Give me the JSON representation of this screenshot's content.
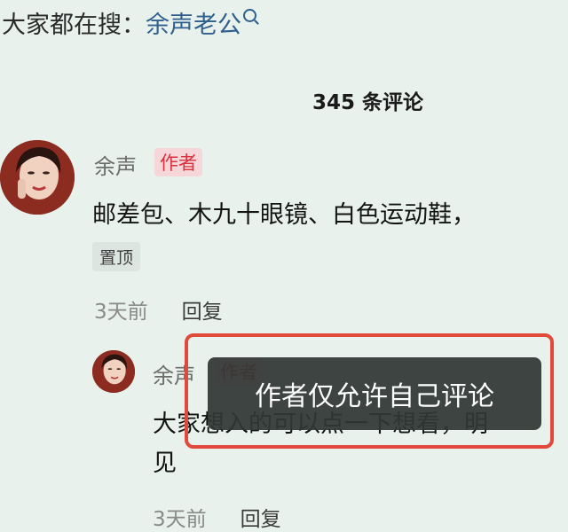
{
  "search_hint": {
    "prefix": "大家都在搜：",
    "keyword": "余声老公"
  },
  "comment_count": "345 条评论",
  "comments": [
    {
      "username": "余声",
      "badge": "作者",
      "text": "邮差包、木九十眼镜、白色运动鞋，",
      "pin": "置顶",
      "time": "3天前",
      "reply": "回复"
    },
    {
      "username": "余声",
      "badge": "作者",
      "text": "大家想入的可以点一下想看，明",
      "text_line2": "见",
      "time": "3天前",
      "reply": "回复"
    }
  ],
  "toast": "作者仅允许自己评论",
  "colors": {
    "background": "#e8f1ec",
    "keyword": "#2e5f8f",
    "badge_text": "#d9313e",
    "highlight": "#e14a3a"
  }
}
